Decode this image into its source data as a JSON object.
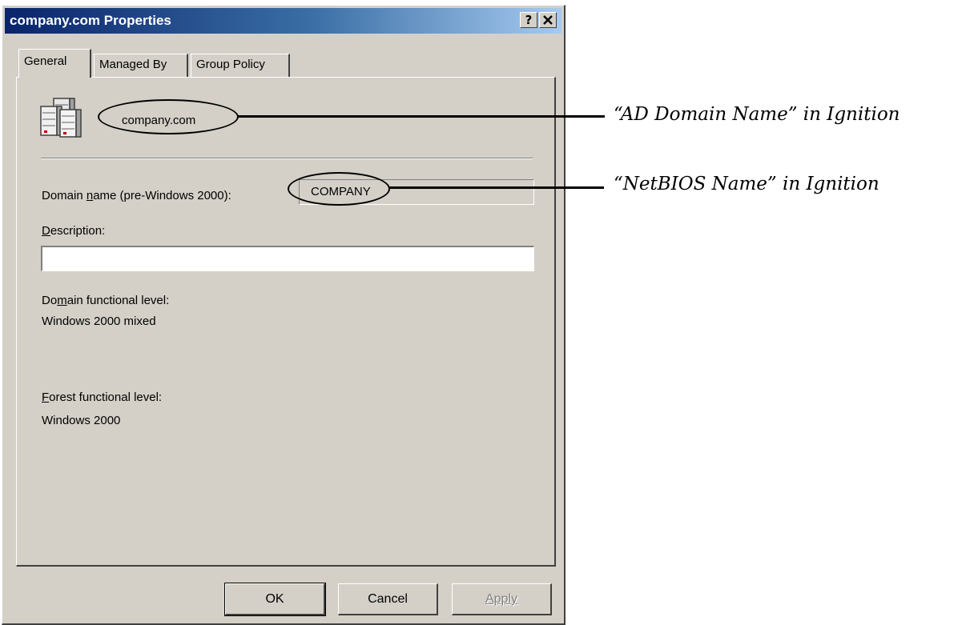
{
  "window": {
    "title": "company.com Properties",
    "help_label": "?",
    "close_label": "✕"
  },
  "tabs": [
    {
      "label": "General",
      "active": true
    },
    {
      "label": "Managed By",
      "active": false
    },
    {
      "label": "Group Policy",
      "active": false
    }
  ],
  "general": {
    "domain_icon": "server-icon",
    "domain_name": "company.com",
    "netbios_label_pre": "Domain ",
    "netbios_label_mnemonic": "n",
    "netbios_label_post": "ame (pre-Windows 2000):",
    "netbios_value": "COMPANY",
    "description_label_mnemonic": "D",
    "description_label_rest": "escription:",
    "description_value": "",
    "dfl_label_pre": "Do",
    "dfl_label_mnemonic": "m",
    "dfl_label_post": "ain functional level:",
    "dfl_value": "Windows 2000 mixed",
    "ffl_label_mnemonic": "F",
    "ffl_label_rest": "orest functional level:",
    "ffl_value": "Windows 2000"
  },
  "buttons": {
    "ok": "OK",
    "cancel": "Cancel",
    "apply": "Apply",
    "apply_enabled": false
  },
  "annotations": {
    "ad_domain": "“AD Domain Name” in Ignition",
    "netbios": "“NetBIOS Name” in Ignition"
  },
  "colors": {
    "dialog_face": "#d4d0c8",
    "titlebar_start": "#0a246a",
    "titlebar_end": "#a6caf0"
  }
}
